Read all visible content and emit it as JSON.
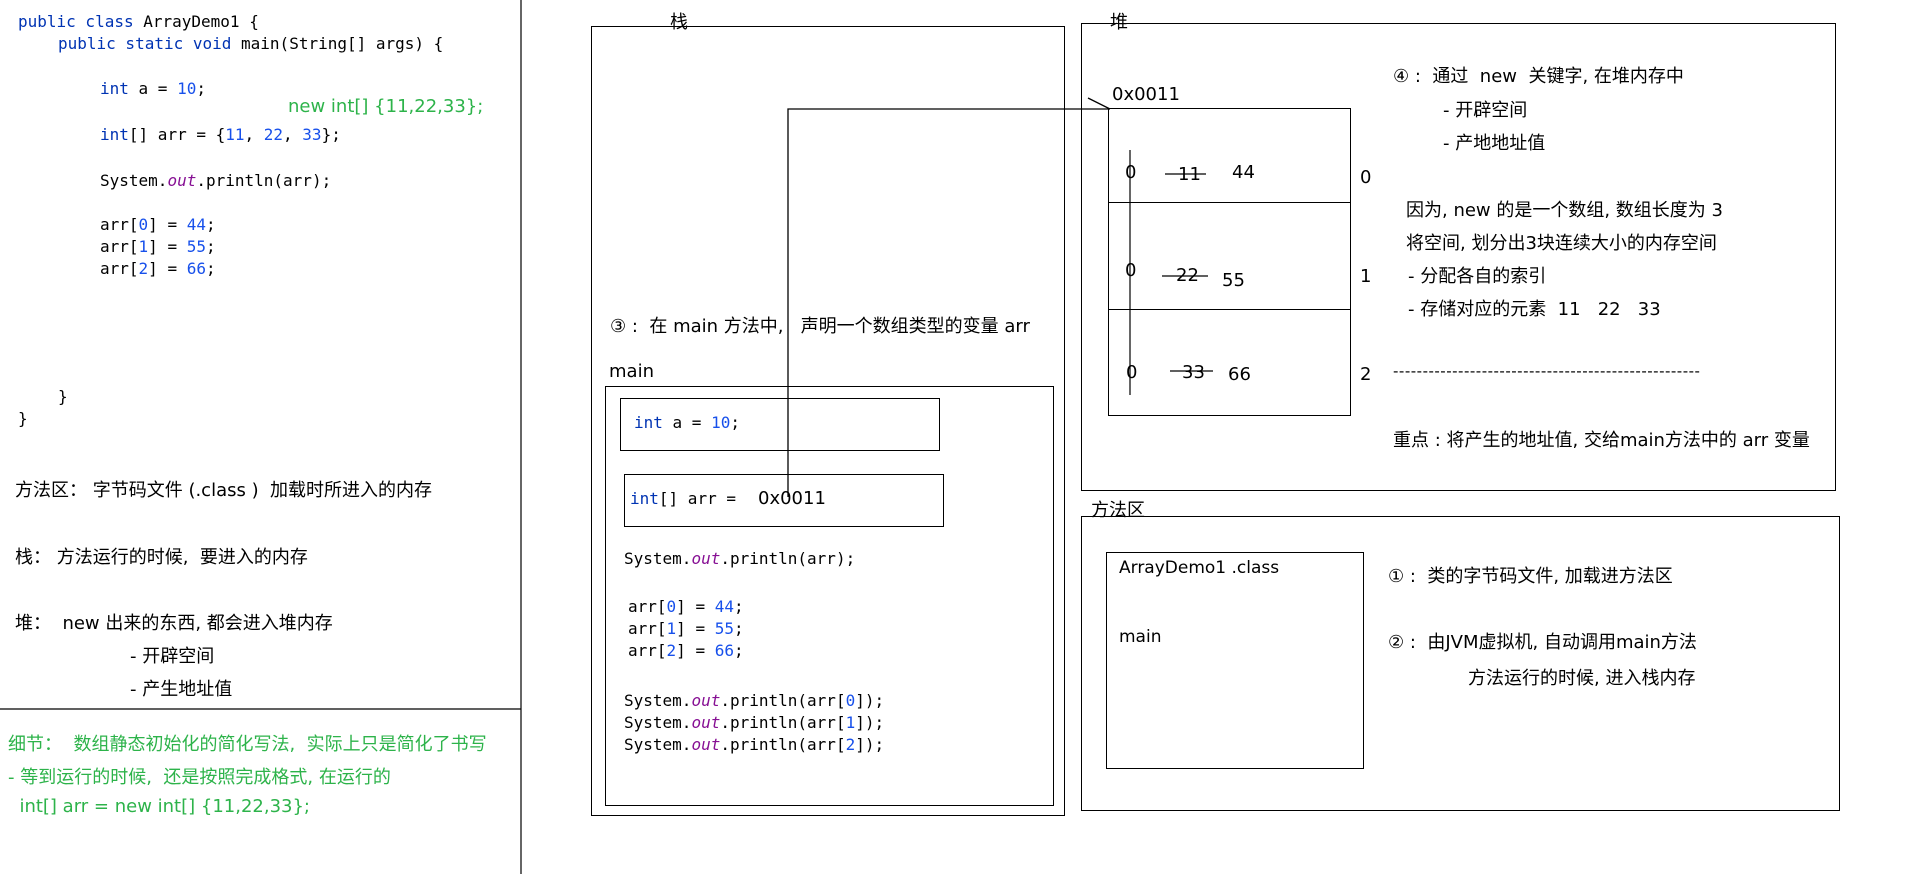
{
  "left_panel": {
    "code": {
      "l1_kw": "public class",
      "l1_rest": " ArrayDemo1 {",
      "l2_kw": "public static void",
      "l2_rest": " main(String[] args) {",
      "l3_kw": "int",
      "l3_a": " a = ",
      "l3_num": "10",
      "l3_end": ";",
      "l4_kw": "int",
      "l4_a": "[] arr = {",
      "l4_n1": "11",
      "l4_c1": ", ",
      "l4_n2": "22",
      "l4_c2": ", ",
      "l4_n3": "33",
      "l4_end": "};",
      "l5_a": "System.",
      "l5_out": "out",
      "l5_b": ".println(arr);",
      "l6_a": "arr[",
      "l6_i": "0",
      "l6_b": "] = ",
      "l6_v": "44",
      "l6_e": ";",
      "l7_a": "arr[",
      "l7_i": "1",
      "l7_b": "] = ",
      "l7_v": "55",
      "l7_e": ";",
      "l8_a": "arr[",
      "l8_i": "2",
      "l8_b": "] = ",
      "l8_v": "66",
      "l8_e": ";",
      "close_method": "}",
      "close_class": "}"
    },
    "note_new_int": "new int[] {11,22,33};",
    "method_area_desc": "方法区： 字节码文件 (.class )  加载时所进入的内存",
    "stack_desc": "栈： 方法运行的时候,  要进入的内存",
    "heap_desc": "堆：  new 出来的东西, 都会进入堆内存",
    "heap_sub1": "- 开辟空间",
    "heap_sub2": "- 产生地址值",
    "detail_1": "细节：  数组静态初始化的简化写法,  实际上只是简化了书写",
    "detail_2": "- 等到运行的时候,  还是按照完成格式, 在运行的",
    "detail_3": "  int[] arr = new int[] {11,22,33};"
  },
  "stack_panel": {
    "title": "栈",
    "step3": "③ :  在 main 方法中,   声明一个数组类型的变量 arr",
    "frame_label": "main",
    "var_a_kw": "int",
    "var_a_rest": " a = ",
    "var_a_num": "10",
    "var_a_end": ";",
    "var_arr_kw": "int",
    "var_arr_rest": "[] arr = ",
    "var_arr_value": "0x0011",
    "println_a": "System.",
    "println_out": "out",
    "println_b": ".println(arr);",
    "a0_a": "arr[",
    "a0_i": "0",
    "a0_b": "] = ",
    "a0_v": "44",
    "a0_e": ";",
    "a1_a": "arr[",
    "a1_i": "1",
    "a1_b": "] = ",
    "a1_v": "55",
    "a1_e": ";",
    "a2_a": "arr[",
    "a2_i": "2",
    "a2_b": "] = ",
    "a2_v": "66",
    "a2_e": ";",
    "p0_a": "System.",
    "p0_out": "out",
    "p0_b": ".println(arr[",
    "p0_i": "0",
    "p0_c": "]);",
    "p1_a": "System.",
    "p1_out": "out",
    "p1_b": ".println(arr[",
    "p1_i": "1",
    "p1_c": "]);",
    "p2_a": "System.",
    "p2_out": "out",
    "p2_b": ".println(arr[",
    "p2_i": "2",
    "p2_c": "]);"
  },
  "heap_panel": {
    "title": "堆",
    "address": "0x0011",
    "cells": [
      {
        "default": "0",
        "old": "11",
        "new": "44",
        "index": "0"
      },
      {
        "default": "0",
        "old": "22",
        "new": "55",
        "index": "1"
      },
      {
        "default": "0",
        "old": "33",
        "new": "66",
        "index": "2"
      }
    ],
    "step4_title": "④ :  通过  new  关键字, 在堆内存中",
    "step4_sub1": "- 开辟空间",
    "step4_sub2": "- 产地地址值",
    "because_1": "因为, new 的是一个数组, 数组长度为 3",
    "because_2": "将空间, 划分出3块连续大小的内存空间",
    "because_3": "- 分配各自的索引",
    "because_4": "- 存储对应的元素  11   22   33",
    "separator": "----------------------------------------------------",
    "key_point": "重点 : 将产生的地址值, 交给main方法中的 arr 变量"
  },
  "method_area_panel": {
    "title": "方法区",
    "class_file": "ArrayDemo1 .class",
    "method": "main",
    "step1": "① :  类的字节码文件, 加载进方法区",
    "step2": "② :  由JVM虚拟机, 自动调用main方法",
    "step2_sub": "方法运行的时候, 进入栈内存"
  }
}
